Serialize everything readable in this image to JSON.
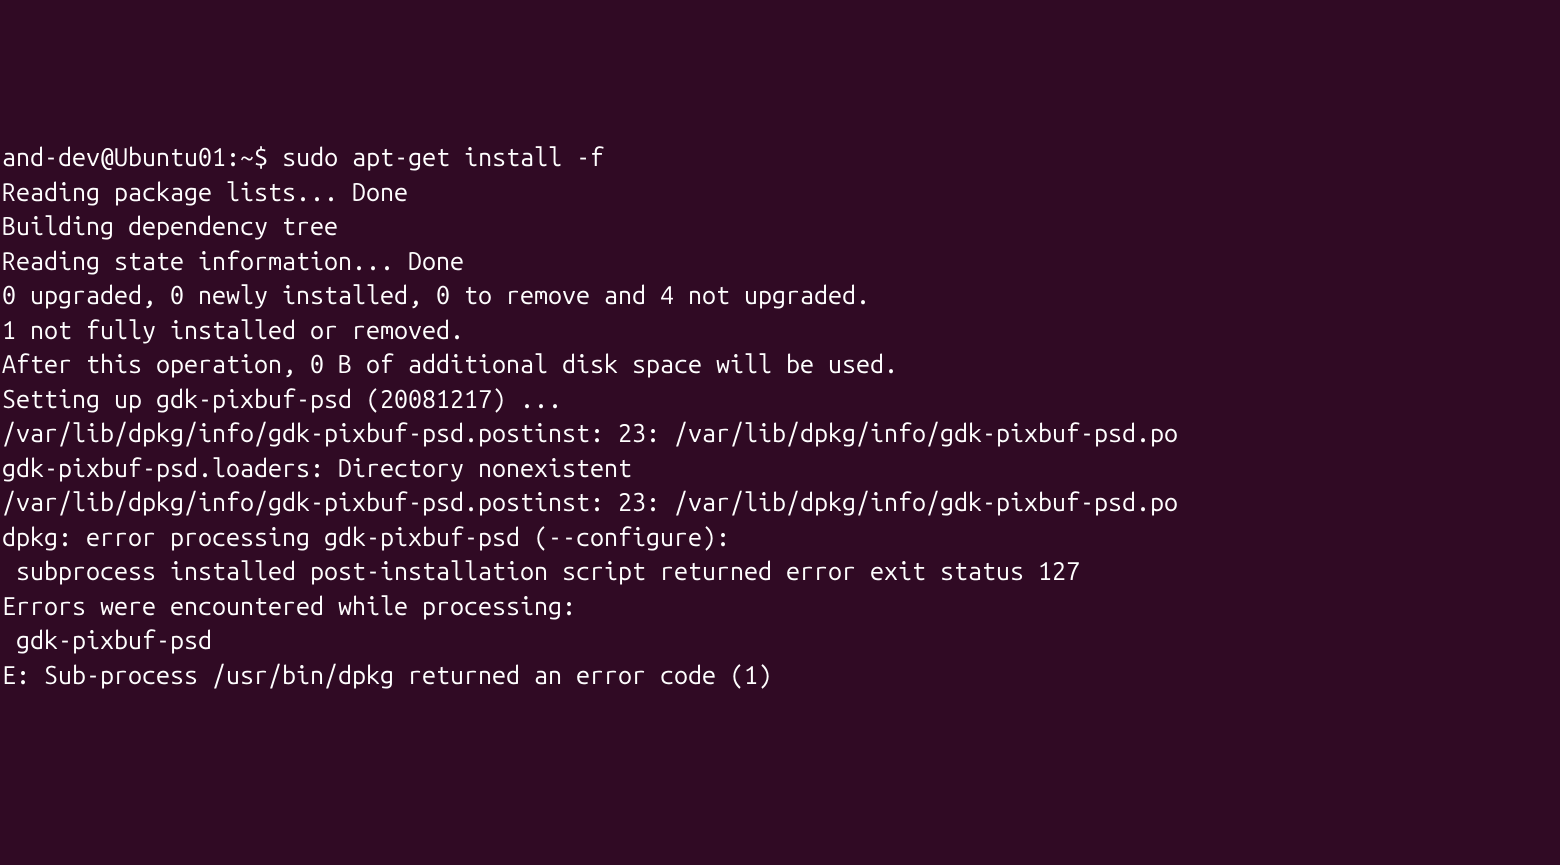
{
  "terminal": {
    "prompt": {
      "userhost": "and-dev@Ubuntu01",
      "path": "~",
      "symbol": "$"
    },
    "command": "sudo apt-get install -f",
    "lines": [
      "Reading package lists... Done",
      "Building dependency tree",
      "Reading state information... Done",
      "0 upgraded, 0 newly installed, 0 to remove and 4 not upgraded.",
      "1 not fully installed or removed.",
      "After this operation, 0 B of additional disk space will be used.",
      "Setting up gdk-pixbuf-psd (20081217) ...",
      "/var/lib/dpkg/info/gdk-pixbuf-psd.postinst: 23: /var/lib/dpkg/info/gdk-pixbuf-psd.po",
      "gdk-pixbuf-psd.loaders: Directory nonexistent",
      "/var/lib/dpkg/info/gdk-pixbuf-psd.postinst: 23: /var/lib/dpkg/info/gdk-pixbuf-psd.po",
      "dpkg: error processing gdk-pixbuf-psd (--configure):",
      " subprocess installed post-installation script returned error exit status 127",
      "Errors were encountered while processing:",
      " gdk-pixbuf-psd",
      "E: Sub-process /usr/bin/dpkg returned an error code (1)"
    ]
  }
}
